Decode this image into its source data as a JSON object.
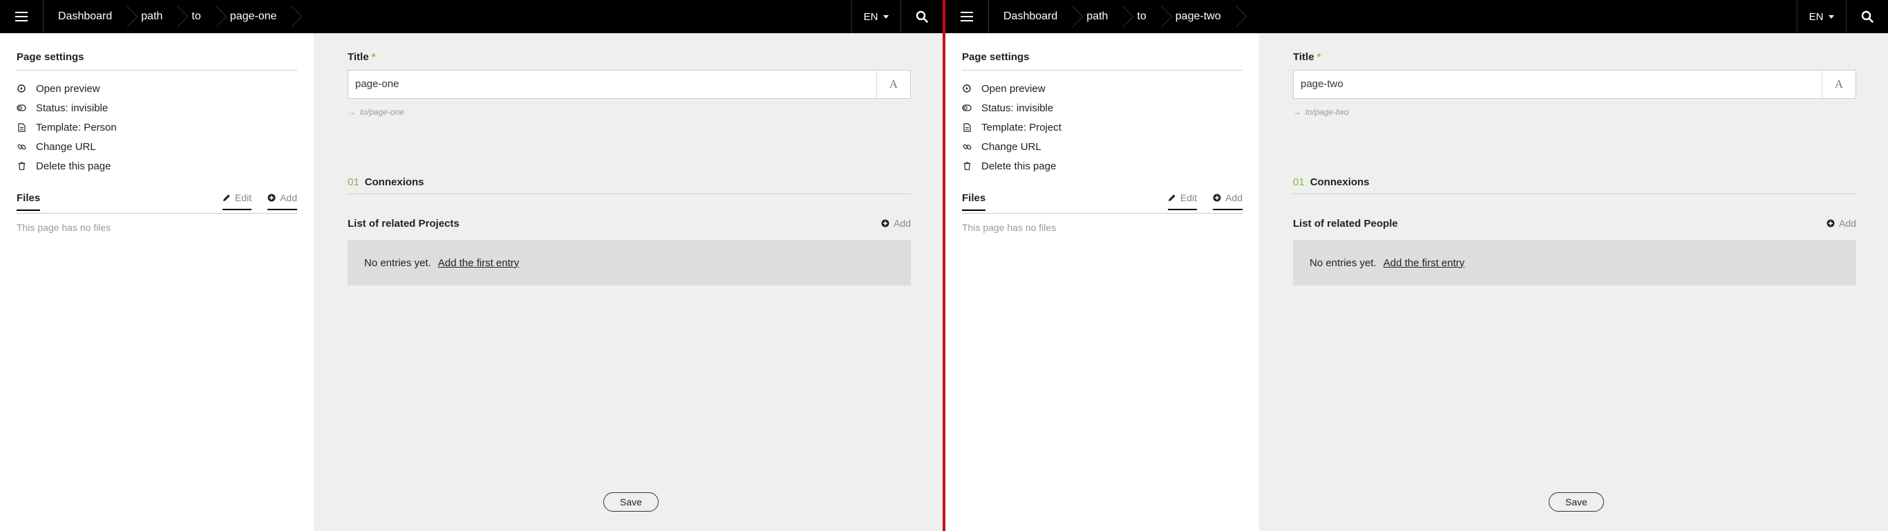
{
  "panes": [
    {
      "breadcrumbs": [
        "Dashboard",
        "path",
        "to",
        "page-one"
      ],
      "lang": "EN",
      "sidebar": {
        "title": "Page settings",
        "items": [
          {
            "icon": "play-circle-icon",
            "label": "Open preview"
          },
          {
            "icon": "toggle-icon",
            "label": "Status: invisible"
          },
          {
            "icon": "document-icon",
            "label": "Template: Person"
          },
          {
            "icon": "link-icon",
            "label": "Change URL"
          },
          {
            "icon": "trash-icon",
            "label": "Delete this page"
          }
        ],
        "files_title": "Files",
        "files_edit": "Edit",
        "files_add": "Add",
        "files_empty": "This page has no files"
      },
      "main": {
        "title_label": "Title",
        "required_mark": "*",
        "title_value": "page-one",
        "format_icon_label": "A",
        "slug_arrow": "→",
        "slug": "to/page-one",
        "connexions_number": "01",
        "connexions_label": "Connexions",
        "related_title": "List of related Projects",
        "related_add": "Add",
        "empty_text": "No entries yet.",
        "empty_link": "Add the first entry",
        "save_label": "Save"
      }
    },
    {
      "breadcrumbs": [
        "Dashboard",
        "path",
        "to",
        "page-two"
      ],
      "lang": "EN",
      "sidebar": {
        "title": "Page settings",
        "items": [
          {
            "icon": "play-circle-icon",
            "label": "Open preview"
          },
          {
            "icon": "toggle-icon",
            "label": "Status: invisible"
          },
          {
            "icon": "document-icon",
            "label": "Template: Project"
          },
          {
            "icon": "link-icon",
            "label": "Change URL"
          },
          {
            "icon": "trash-icon",
            "label": "Delete this page"
          }
        ],
        "files_title": "Files",
        "files_edit": "Edit",
        "files_add": "Add",
        "files_empty": "This page has no files"
      },
      "main": {
        "title_label": "Title",
        "required_mark": "*",
        "title_value": "page-two",
        "format_icon_label": "A",
        "slug_arrow": "→",
        "slug": "to/page-two",
        "connexions_number": "01",
        "connexions_label": "Connexions",
        "related_title": "List of related People",
        "related_add": "Add",
        "empty_text": "No entries yet.",
        "empty_link": "Add the first entry",
        "save_label": "Save"
      }
    }
  ],
  "colors": {
    "topbar": "#000000",
    "divider": "#d0021b",
    "main_bg": "#eef0ee",
    "required": "#b9a94a",
    "connexions_number": "#8fae45",
    "empty_box": "#dcdddc"
  }
}
